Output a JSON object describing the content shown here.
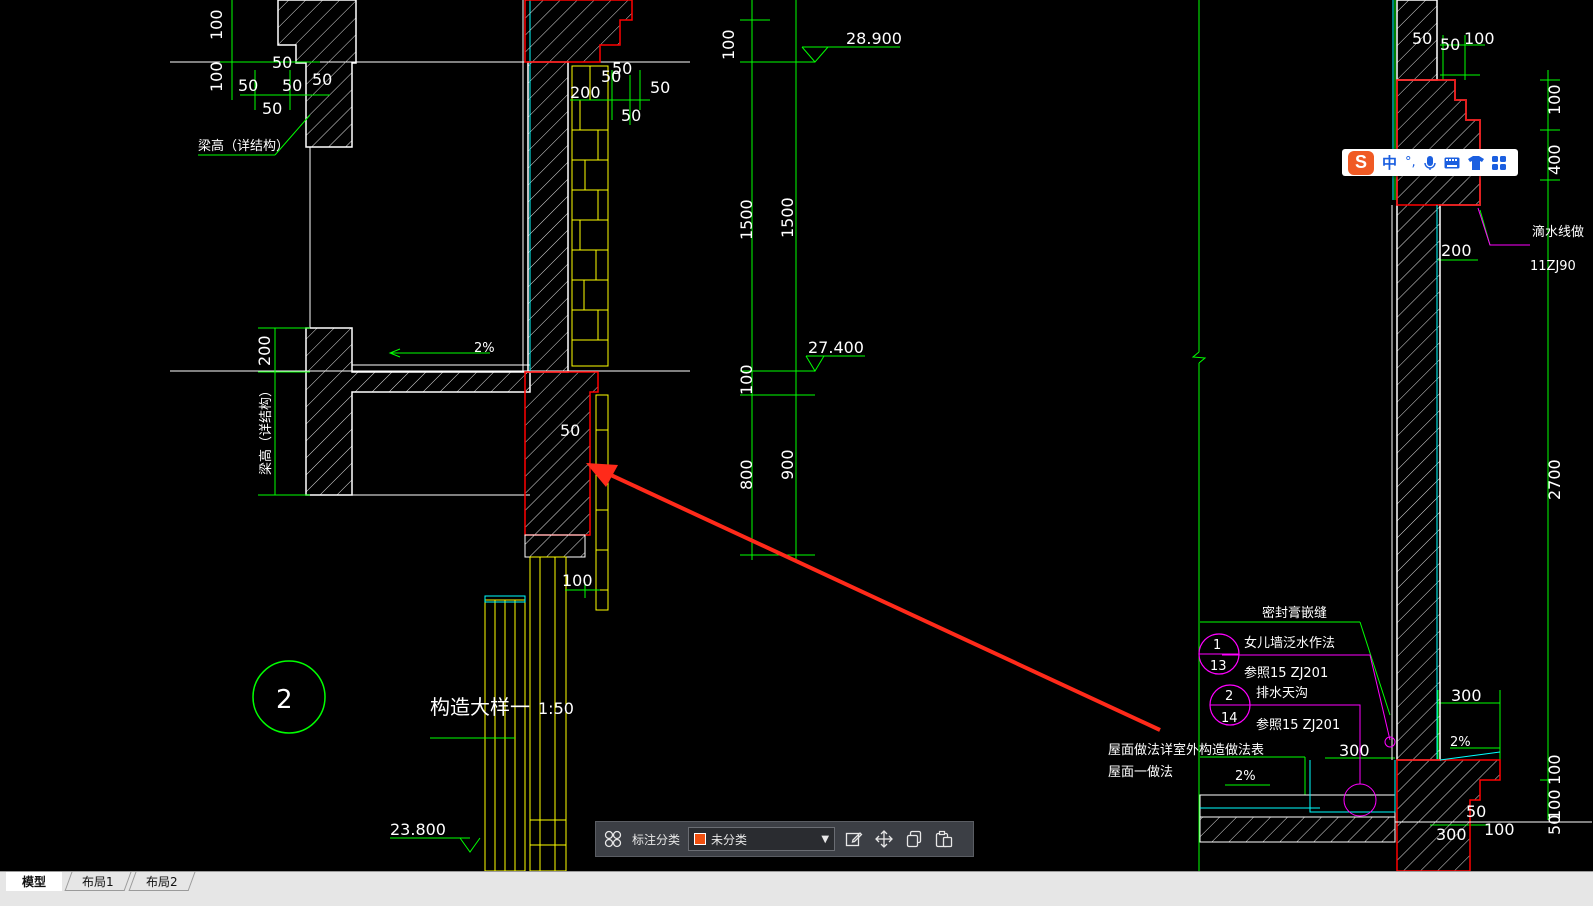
{
  "drawing": {
    "elevations": [
      "28.900",
      "27.400",
      "23.800"
    ],
    "dims_left": [
      "100",
      "100",
      "50",
      "50",
      "50",
      "50",
      "50",
      "200"
    ],
    "dims_center": [
      "50",
      "50",
      "200",
      "50",
      "50",
      "50",
      "100"
    ],
    "dims_vert": [
      "100",
      "1500",
      "1500",
      "100",
      "800",
      "900"
    ],
    "dims_right": [
      "50",
      "50",
      "100",
      "100",
      "400",
      "200",
      "2700",
      "300",
      "300",
      "300",
      "50",
      "100",
      "50",
      "100",
      "100"
    ],
    "slope": "2%",
    "slope2": "2%",
    "slope3": "2%",
    "beam_note_top": "梁高（详结构）",
    "beam_note_side": "梁高（详结构）",
    "detail_number": "2",
    "detail_title": "构造大样一",
    "detail_scale": "1:50",
    "drip_note": "滴水线做",
    "drip_ref": "11ZJ90",
    "seal_note": "密封膏嵌缝",
    "callout1_top": "1",
    "callout1_bottom": "13",
    "callout1_text": "女儿墙泛水作法",
    "callout1_ref": "参照15 ZJ201",
    "callout2_top": "2",
    "callout2_bottom": "14",
    "callout2_text": "排水天沟",
    "callout2_ref": "参照15 ZJ201",
    "roof_note": "屋面做法详室外构造做法表",
    "roof_note2": "屋面一做法"
  },
  "ime": {
    "zh_label": "中",
    "punct": "°,",
    "mic": "mic-icon",
    "keyboard": "keyboard-icon",
    "skin": "shirt-icon",
    "apps": "grid-icon"
  },
  "annotation_bar": {
    "label": "标注分类",
    "selected": "未分类",
    "swatch_color": "#f05010"
  },
  "tabs": [
    "模型",
    "布局1",
    "布局2"
  ],
  "colors": {
    "green": "#00ff00",
    "white": "#ffffff",
    "red": "#ff0000",
    "yellow": "#ffff00",
    "cyan": "#00ffff",
    "magenta": "#ff00ff",
    "arrow": "#ff2a1a"
  }
}
